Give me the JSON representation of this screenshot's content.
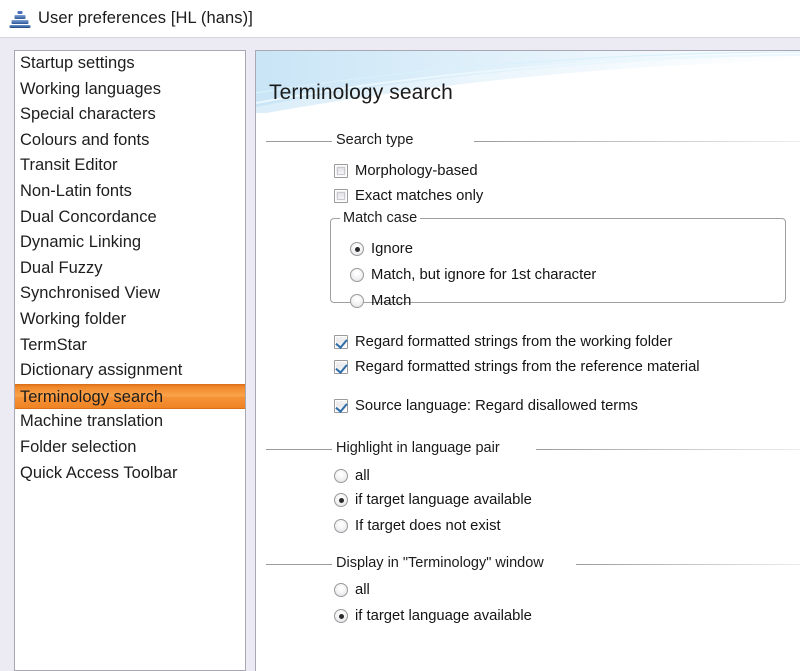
{
  "window": {
    "title": "User preferences [HL (hans)]",
    "icon": "pyramid-logo-icon"
  },
  "sidebar": {
    "items": [
      {
        "label": "Startup settings",
        "selected": false
      },
      {
        "label": "Working languages",
        "selected": false
      },
      {
        "label": "Special characters",
        "selected": false
      },
      {
        "label": "Colours and fonts",
        "selected": false
      },
      {
        "label": "Transit Editor",
        "selected": false
      },
      {
        "label": "Non-Latin fonts",
        "selected": false
      },
      {
        "label": "Dual Concordance",
        "selected": false
      },
      {
        "label": "Dynamic Linking",
        "selected": false
      },
      {
        "label": "Dual Fuzzy",
        "selected": false
      },
      {
        "label": "Synchronised View",
        "selected": false
      },
      {
        "label": "Working folder",
        "selected": false
      },
      {
        "label": "TermStar",
        "selected": false
      },
      {
        "label": "Dictionary assignment",
        "selected": false
      },
      {
        "label": "Terminology search",
        "selected": true
      },
      {
        "label": "Machine translation",
        "selected": false
      },
      {
        "label": "Folder selection",
        "selected": false
      },
      {
        "label": "Quick Access Toolbar",
        "selected": false
      }
    ],
    "selected_color": "#f59338"
  },
  "panel": {
    "title": "Terminology search",
    "banner_color": "#bfe0f5",
    "groups": {
      "search_type": {
        "label": "Search type",
        "checkboxes": [
          {
            "label": "Morphology-based",
            "checked": false
          },
          {
            "label": "Exact matches only",
            "checked": false
          }
        ]
      },
      "match_case": {
        "label": "Match case",
        "radios": [
          {
            "label": "Ignore",
            "checked": true
          },
          {
            "label": "Match, but ignore for 1st character",
            "checked": false
          },
          {
            "label": "Match",
            "checked": false
          }
        ]
      },
      "formatting": {
        "checkboxes": [
          {
            "label": "Regard formatted strings from the working folder",
            "checked": true
          },
          {
            "label": "Regard formatted strings from the reference material",
            "checked": true
          },
          {
            "label": "Source language: Regard disallowed terms",
            "checked": true
          }
        ]
      },
      "highlight": {
        "label": "Highlight in language pair",
        "radios": [
          {
            "label": "all",
            "checked": false
          },
          {
            "label": "if target language available",
            "checked": true
          },
          {
            "label": "If target does not exist",
            "checked": false
          }
        ]
      },
      "display": {
        "label": "Display in \"Terminology\" window",
        "radios": [
          {
            "label": "all",
            "checked": false
          },
          {
            "label": "if target language available",
            "checked": true
          }
        ]
      }
    }
  }
}
